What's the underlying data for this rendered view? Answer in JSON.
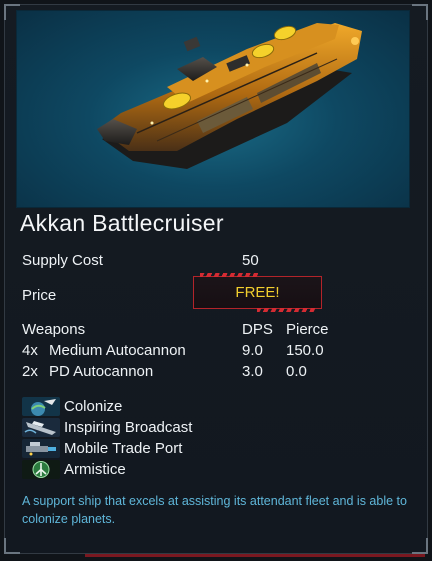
{
  "ship": {
    "name": "Akkan Battlecruiser",
    "portrait_icon": "battlecruiser-ship-portrait"
  },
  "stats": {
    "supply_label": "Supply Cost",
    "supply_value": "50",
    "price_label": "Price",
    "price_value": "FREE!"
  },
  "weapons": {
    "header": {
      "weapons": "Weapons",
      "dps": "DPS",
      "pierce": "Pierce"
    },
    "rows": [
      {
        "count": "4x",
        "name": "Medium Autocannon",
        "dps": "9.0",
        "pierce": "150.0"
      },
      {
        "count": "2x",
        "name": "PD Autocannon",
        "dps": "3.0",
        "pierce": "0.0"
      }
    ]
  },
  "abilities": [
    {
      "name": "Colonize",
      "icon": "colonize-icon"
    },
    {
      "name": "Inspiring Broadcast",
      "icon": "broadcast-icon"
    },
    {
      "name": "Mobile Trade Port",
      "icon": "trade-port-icon"
    },
    {
      "name": "Armistice",
      "icon": "armistice-icon"
    }
  ],
  "description": "A support ship that excels at assisting its attendant fleet and is able to colonize planets.",
  "colors": {
    "panel_bg": "#151b22",
    "price_border": "#b3242a",
    "price_text": "#f1ce2e",
    "description_text": "#5fb6d9",
    "portrait_bg": "#0e4862"
  }
}
